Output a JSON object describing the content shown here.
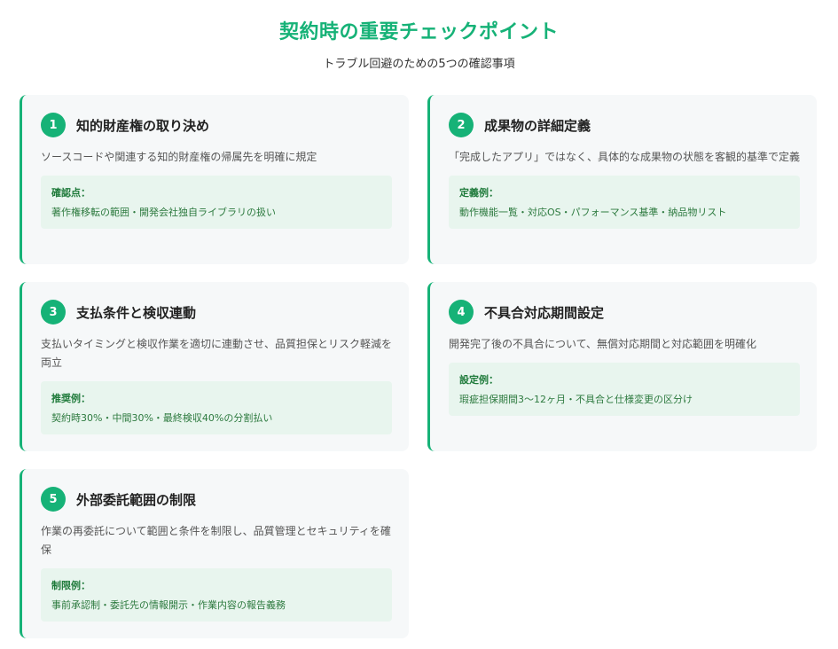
{
  "header": {
    "title": "契約時の重要チェックポイント",
    "subtitle": "トラブル回避のための5つの確認事項"
  },
  "colors": {
    "accent": "#16b277",
    "card_bg": "#f6f8f9",
    "detail_bg": "#e8f5ee",
    "detail_text": "#2d7a3f"
  },
  "cards": [
    {
      "number": "1",
      "title": "知的財産権の取り決め",
      "description": "ソースコードや関連する知的財産権の帰属先を明確に規定",
      "detail_label": "確認点：",
      "detail_text": "著作権移転の範囲・開発会社独自ライブラリの扱い"
    },
    {
      "number": "2",
      "title": "成果物の詳細定義",
      "description": "「完成したアプリ」ではなく、具体的な成果物の状態を客観的基準で定義",
      "detail_label": "定義例：",
      "detail_text": "動作機能一覧・対応OS・パフォーマンス基準・納品物リスト"
    },
    {
      "number": "3",
      "title": "支払条件と検収連動",
      "description": "支払いタイミングと検収作業を適切に連動させ、品質担保とリスク軽減を両立",
      "detail_label": "推奨例：",
      "detail_text": "契約時30%・中間30%・最終検収40%の分割払い"
    },
    {
      "number": "4",
      "title": "不具合対応期間設定",
      "description": "開発完了後の不具合について、無償対応期間と対応範囲を明確化",
      "detail_label": "設定例：",
      "detail_text": "瑕疵担保期間3〜12ヶ月・不具合と仕様変更の区分け"
    },
    {
      "number": "5",
      "title": "外部委託範囲の制限",
      "description": "作業の再委託について範囲と条件を制限し、品質管理とセキュリティを確保",
      "detail_label": "制限例：",
      "detail_text": "事前承認制・委託先の情報開示・作業内容の報告義務"
    }
  ]
}
